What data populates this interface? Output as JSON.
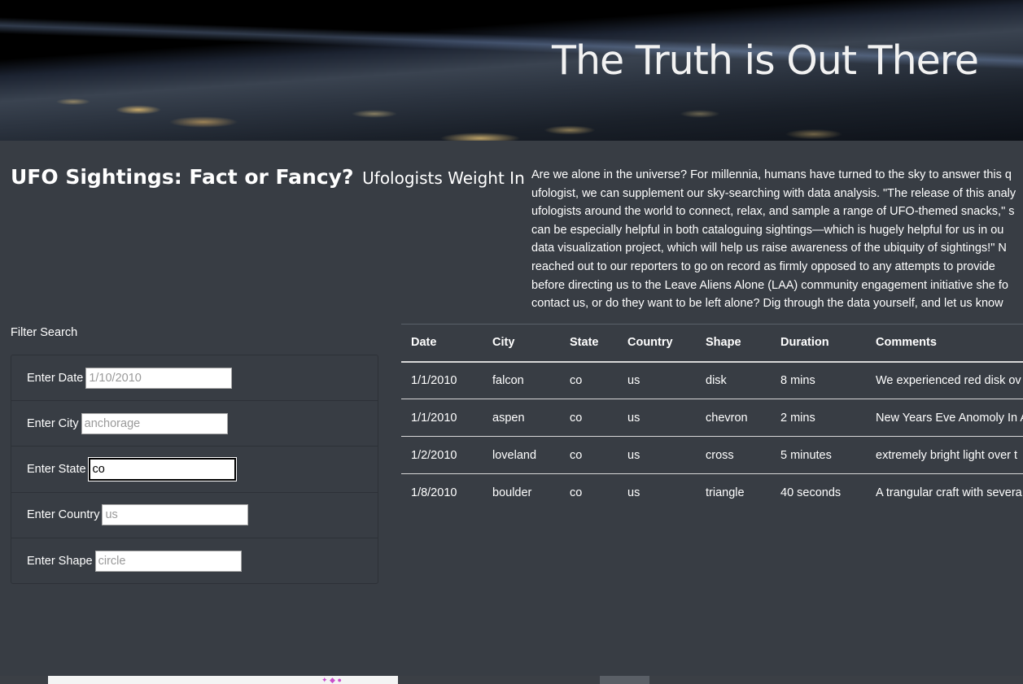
{
  "hero": {
    "title": "The Truth is Out There"
  },
  "heading": {
    "main": "UFO Sightings: Fact or Fancy?",
    "sub": "Ufologists Weight In"
  },
  "intro_lines": [
    "Are we alone in the universe? For millennia, humans have turned to the sky to answer this q",
    "ufologist, we can supplement our sky-searching with data analysis. \"The release of this analy",
    "ufologists around the world to connect, relax, and sample a range of UFO-themed snacks,\" s",
    "can be especially helpful in both cataloguing sightings—which is hugely helpful for us in ou",
    "data visualization project, which will help us raise awareness of the ubiquity of sightings!\" N",
    "reached out to our reporters to go on record as firmly opposed to any attempts to provide",
    "before directing us to the Leave Aliens Alone (LAA) community engagement initiative she fo",
    "contact us, or do they want to be left alone? Dig through the data yourself, and let us know"
  ],
  "filter": {
    "title": "Filter Search",
    "fields": [
      {
        "label": "Enter Date",
        "placeholder": "1/10/2010",
        "value": ""
      },
      {
        "label": "Enter City",
        "placeholder": "anchorage",
        "value": ""
      },
      {
        "label": "Enter State",
        "placeholder": "",
        "value": "co"
      },
      {
        "label": "Enter Country",
        "placeholder": "us",
        "value": ""
      },
      {
        "label": "Enter Shape",
        "placeholder": "circle",
        "value": ""
      }
    ]
  },
  "table": {
    "columns": [
      "Date",
      "City",
      "State",
      "Country",
      "Shape",
      "Duration",
      "Comments"
    ],
    "rows": [
      [
        "1/1/2010",
        "falcon",
        "co",
        "us",
        "disk",
        "8 mins",
        "We experienced red disk ov"
      ],
      [
        "1/1/2010",
        "aspen",
        "co",
        "us",
        "chevron",
        "2 mins",
        "New Years Eve Anomoly In A"
      ],
      [
        "1/2/2010",
        "loveland",
        "co",
        "us",
        "cross",
        "5 minutes",
        "extremely bright light over t"
      ],
      [
        "1/8/2010",
        "boulder",
        "co",
        "us",
        "triangle",
        "40 seconds",
        "A trangular craft with severa"
      ]
    ]
  },
  "colors": {
    "background": "#383d44",
    "text": "#ffffff",
    "table_rule": "#d8d8d8"
  }
}
